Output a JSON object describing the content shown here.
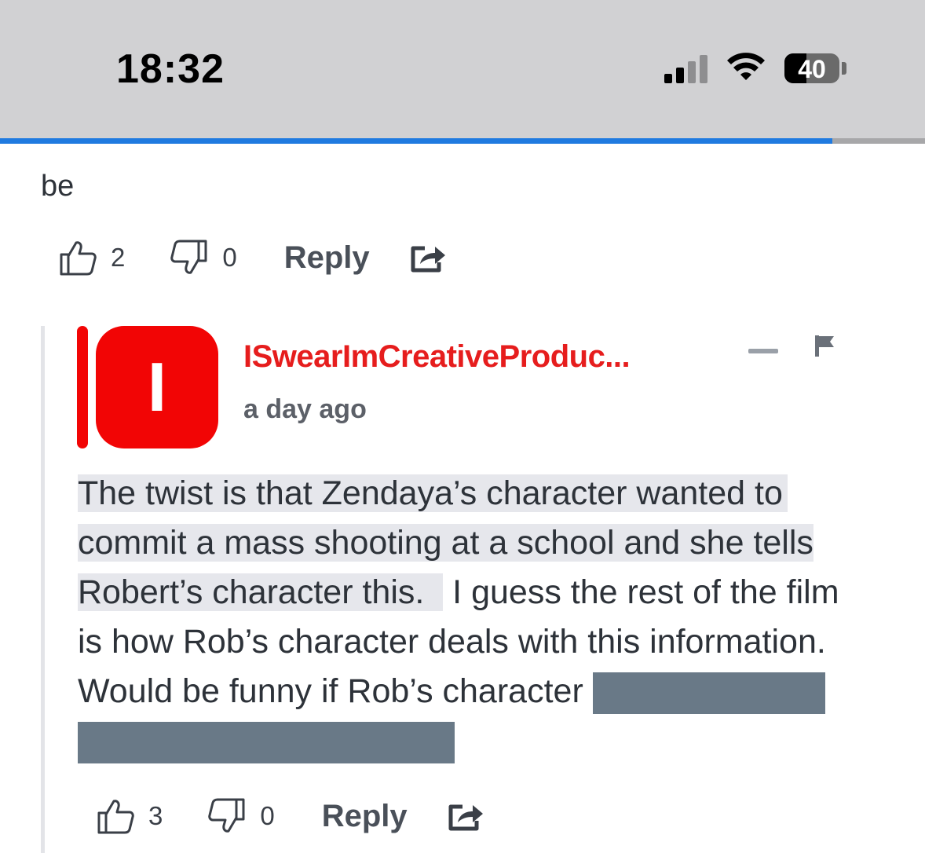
{
  "status_bar": {
    "time": "18:32",
    "battery": "40",
    "read_progress": 0.9
  },
  "previous_comment": {
    "text_tail": "be",
    "upvotes": "2",
    "downvotes": "0",
    "reply_label": "Reply"
  },
  "reply_comment": {
    "avatar_letter": "I",
    "username": "ISwearImCreativeProduc...",
    "time": "a day ago",
    "text_highlighted_1": " The twist is that Zendaya’s character wanted to",
    "text_highlighted_2": "commit a mass shooting at a school and she tells",
    "text_highlighted_3": "Robert’s character this.  ",
    "text_plain_1": " I guess the rest of the film",
    "text_plain_2": "is how Rob’s character deals with this information.",
    "text_plain_3": "Would be funny if Rob’s character ",
    "upvotes": "3",
    "downvotes": "0",
    "reply_label": "Reply"
  },
  "colors": {
    "accent_red": "#f20505",
    "username_red": "#e61d1d",
    "spoiler": "#697987",
    "progress_blue": "#1f7ae0"
  },
  "icons": [
    "thumbs-up-icon",
    "thumbs-down-icon",
    "share-icon",
    "flag-icon",
    "collapse-icon",
    "signal-icon",
    "wifi-icon",
    "battery-icon"
  ]
}
